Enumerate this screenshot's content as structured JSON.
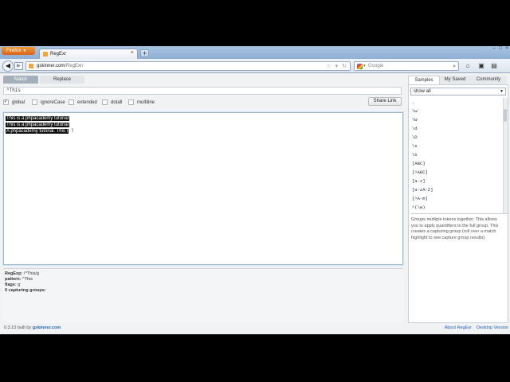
{
  "browser": {
    "menu_label": "Firefox",
    "tab_title": "RegExr",
    "url_host": "gskinner.com",
    "url_path": "/RegExr/",
    "search_placeholder": "Google"
  },
  "app": {
    "mode_tabs": [
      "Match",
      "Replace"
    ],
    "pattern": "^This",
    "flags": [
      {
        "label": "global",
        "checked": true
      },
      {
        "label": "ignoreCase",
        "checked": false
      },
      {
        "label": "extended",
        "checked": false
      },
      {
        "label": "dotall",
        "checked": false
      },
      {
        "label": "multiline",
        "checked": false
      }
    ],
    "share_label": "Share Link",
    "text_lines": [
      {
        "match": "This is a phpacademy tutorial",
        "rest": ""
      },
      {
        "match": "This is a phpacademy tutorial",
        "rest": ""
      },
      {
        "match": "A phpacademy tutorial. This i",
        "rest": ""
      }
    ],
    "results": [
      {
        "key": "RegExp:",
        "value": "/^This/g"
      },
      {
        "key": "pattern:",
        "value": "^This"
      },
      {
        "key": "flags:",
        "value": "g"
      },
      {
        "key": "0 capturing groups:",
        "value": ""
      }
    ],
    "footer_version": "0.3.15 built by",
    "footer_link": "gskinner.com"
  },
  "sidebar": {
    "tabs": [
      "Samples",
      "My Saved",
      "Community"
    ],
    "filter": "show all",
    "samples": [
      ".",
      "\\w",
      "\\W",
      "\\d",
      "\\D",
      "\\s",
      "\\S",
      "[ABC]",
      "[^ABC]",
      "[a-z]",
      "[a-zA-Z]",
      "[^A-m]",
      "^(\\w)"
    ],
    "description": "Groups multiple tokens together. This allows you to apply quantifiers to the full group. This creates a capturing group (roll over a match highlight to see capture group results).",
    "footer_links": [
      "About RegExr",
      "Desktop Version"
    ]
  }
}
